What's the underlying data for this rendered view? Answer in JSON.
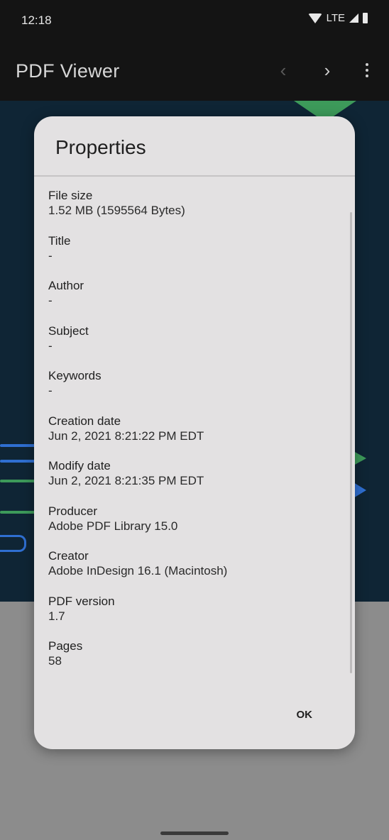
{
  "status_bar": {
    "time": "12:18",
    "network": "LTE"
  },
  "app_bar": {
    "title": "PDF Viewer",
    "prev_icon": "chevron-left-icon",
    "next_icon": "chevron-right-icon",
    "more_icon": "more-vert-icon"
  },
  "dialog": {
    "title": "Properties",
    "ok_label": "OK",
    "properties": [
      {
        "label": "File size",
        "value": "1.52 MB (1595564 Bytes)"
      },
      {
        "label": "Title",
        "value": "-"
      },
      {
        "label": "Author",
        "value": "-"
      },
      {
        "label": "Subject",
        "value": "-"
      },
      {
        "label": "Keywords",
        "value": "-"
      },
      {
        "label": "Creation date",
        "value": "Jun 2, 2021 8:21:22 PM EDT"
      },
      {
        "label": "Modify date",
        "value": "Jun 2, 2021 8:21:35 PM EDT"
      },
      {
        "label": "Producer",
        "value": "Adobe PDF Library 15.0"
      },
      {
        "label": "Creator",
        "value": "Adobe InDesign 16.1 (Macintosh)"
      },
      {
        "label": "PDF version",
        "value": "1.7"
      },
      {
        "label": "Pages",
        "value": "58"
      }
    ]
  },
  "colors": {
    "doc_background": "#0f2535",
    "accent_green": "#3d9a5a",
    "accent_blue": "#2f6fd1"
  }
}
